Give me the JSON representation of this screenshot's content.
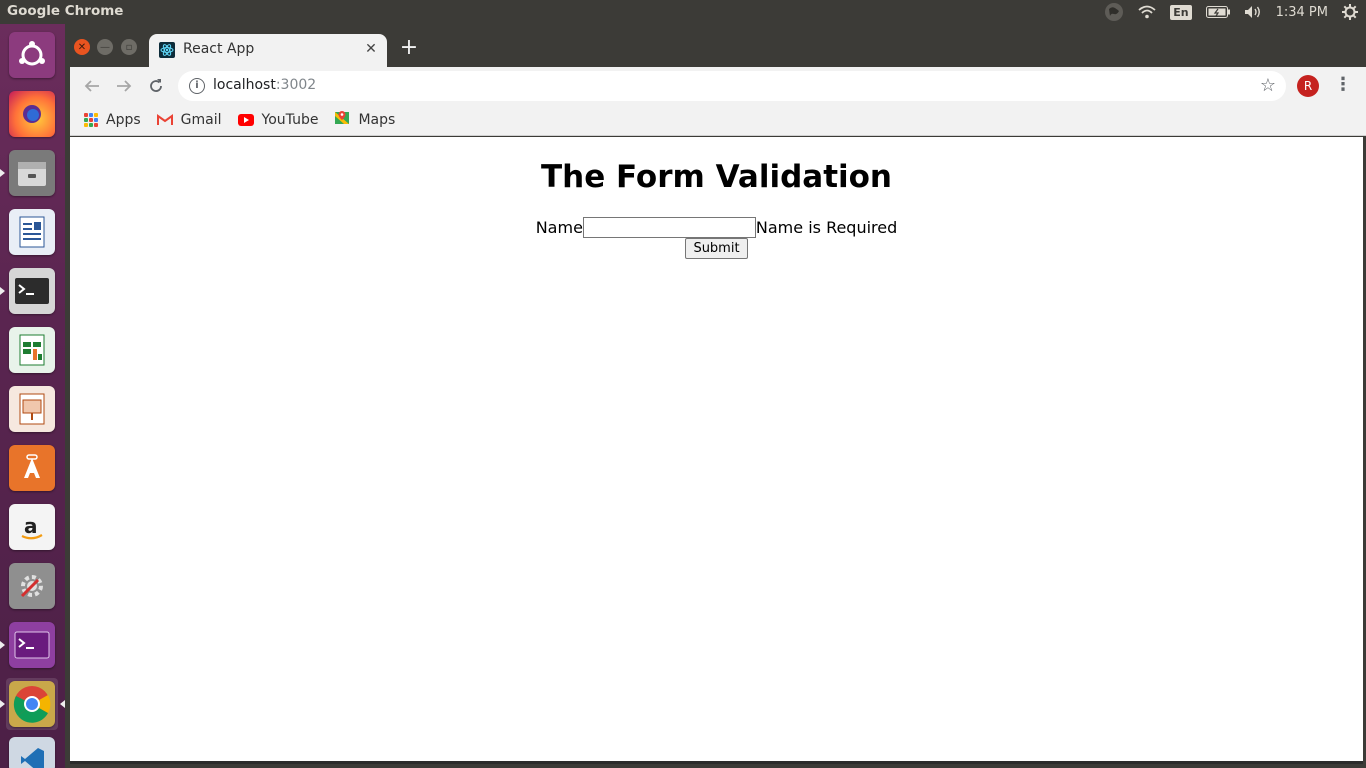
{
  "top_panel": {
    "app_title": "Google Chrome",
    "language": "En",
    "clock": "1:34 PM"
  },
  "launcher": {
    "items": [
      {
        "name": "Ubuntu Dash",
        "icon": "ubuntu-logo-icon",
        "color": "#8c3b7e"
      },
      {
        "name": "Firefox",
        "icon": "firefox-icon",
        "color": "#e66000"
      },
      {
        "name": "Files",
        "icon": "files-icon",
        "color": "#8a8a8a"
      },
      {
        "name": "LibreOffice Writer",
        "icon": "writer-icon",
        "color": "#2b5797"
      },
      {
        "name": "Terminal",
        "icon": "terminal-icon",
        "color": "#2c2c2c"
      },
      {
        "name": "LibreOffice Calc",
        "icon": "calc-icon",
        "color": "#1e7d32"
      },
      {
        "name": "LibreOffice Impress",
        "icon": "impress-icon",
        "color": "#b04a12"
      },
      {
        "name": "Ubuntu Software",
        "icon": "software-center-icon",
        "color": "#e8742a"
      },
      {
        "name": "Amazon",
        "icon": "amazon-icon",
        "color": "#f0f0f0"
      },
      {
        "name": "System Settings",
        "icon": "settings-icon",
        "color": "#9e9e9e"
      },
      {
        "name": "Terminal 2",
        "icon": "terminal-purple-icon",
        "color": "#7a2a8c"
      },
      {
        "name": "Google Chrome",
        "icon": "chrome-icon",
        "color": "#ffffff"
      },
      {
        "name": "VS Code",
        "icon": "vscode-icon",
        "color": "#1f6fb5"
      }
    ]
  },
  "browser": {
    "tab_title": "React App",
    "url_host": "localhost",
    "url_port": ":3002",
    "profile_initial": "R",
    "bookmarks": [
      {
        "label": "Apps",
        "icon": "apps-grid-icon"
      },
      {
        "label": "Gmail",
        "icon": "gmail-icon"
      },
      {
        "label": "YouTube",
        "icon": "youtube-icon"
      },
      {
        "label": "Maps",
        "icon": "maps-icon"
      }
    ]
  },
  "page": {
    "title": "The Form Validation",
    "name_label": "Name",
    "name_value": "",
    "error_message": "Name is Required",
    "submit_label": "Submit"
  }
}
